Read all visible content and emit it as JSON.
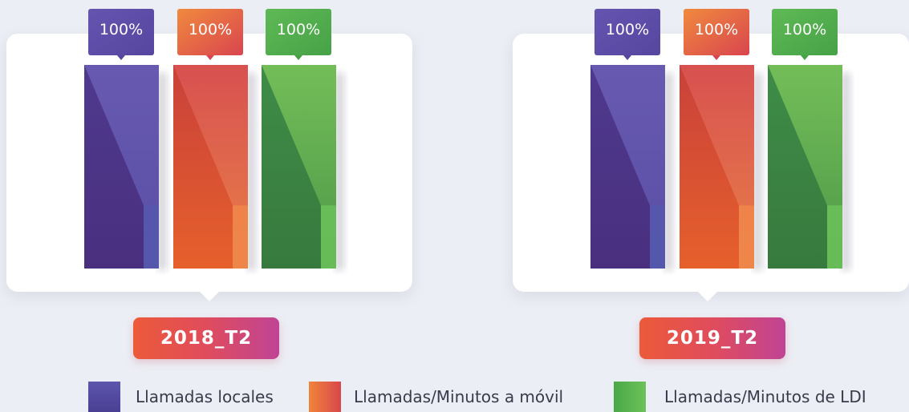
{
  "colors": {
    "background": "#eceef5",
    "badge_gradient": [
      "#ec5a39",
      "#c04495"
    ],
    "series_gradients": {
      "purple": [
        "#4b3487",
        "#5a55a8"
      ],
      "orange": [
        "#e06030",
        "#d94a4a"
      ],
      "green": [
        "#3b7d41",
        "#6cc25a"
      ]
    }
  },
  "chart_data": [
    {
      "type": "bar",
      "title": "2018_T2",
      "categories": [
        "Llamadas locales",
        "Llamadas/Minutos a móvil",
        "Llamadas/Minutos de LDI"
      ],
      "series": [
        {
          "values": [
            100,
            100,
            100
          ]
        }
      ],
      "value_labels": [
        "100%",
        "100%",
        "100%"
      ],
      "ylim": [
        0,
        100
      ],
      "grid": false
    },
    {
      "type": "bar",
      "title": "2019_T2",
      "categories": [
        "Llamadas locales",
        "Llamadas/Minutos a móvil",
        "Llamadas/Minutos de LDI"
      ],
      "series": [
        {
          "values": [
            100,
            100,
            100
          ]
        }
      ],
      "value_labels": [
        "100%",
        "100%",
        "100%"
      ],
      "ylim": [
        0,
        100
      ],
      "grid": false
    }
  ],
  "legend": {
    "placement": "bottom",
    "items": [
      {
        "label": "Llamadas locales",
        "color": "purple"
      },
      {
        "label": "Llamadas/Minutos a móvil",
        "color": "orange"
      },
      {
        "label": "Llamadas/Minutos de LDI",
        "color": "green"
      }
    ]
  }
}
